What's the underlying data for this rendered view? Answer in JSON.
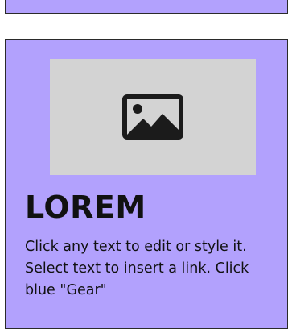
{
  "card": {
    "title": "LOREM",
    "body": "Click any text to edit or style it. Select text to insert a link. Click blue \"Gear\"",
    "image_placeholder_icon": "image-icon"
  },
  "colors": {
    "card_background": "#b2a1fd",
    "card_border": "#2a2a2a",
    "placeholder_background": "#d3d3d3",
    "text": "#111111"
  }
}
